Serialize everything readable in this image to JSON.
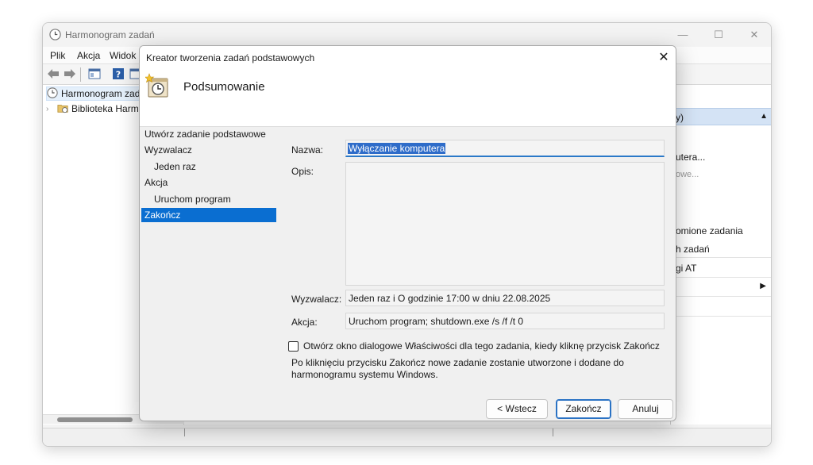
{
  "main_window": {
    "title": "Harmonogram zadań",
    "menu": [
      "Plik",
      "Akcja",
      "Widok"
    ],
    "tree": {
      "root": "Harmonogram zada",
      "library": "Biblioteka Harm"
    },
    "actions_pane": {
      "header": "y)",
      "items": [
        "utera...",
        "owe...",
        "omione zadania",
        "h zadań",
        "gi AT"
      ]
    }
  },
  "dialog": {
    "title": "Kreator tworzenia zadań podstawowych",
    "header_title": "Podsumowanie",
    "steps": [
      {
        "label": "Utwórz zadanie podstawowe"
      },
      {
        "label": "Wyzwalacz"
      },
      {
        "label": "Jeden raz"
      },
      {
        "label": "Akcja"
      },
      {
        "label": "Uruchom program"
      },
      {
        "label": "Zakończ"
      }
    ],
    "name_label": "Nazwa:",
    "name_value": "Wyłączanie komputera",
    "description_label": "Opis:",
    "description_value": "",
    "trigger_label": "Wyzwalacz:",
    "trigger_value": "Jeden raz i O godzinie 17:00 w dniu 22.08.2025",
    "action_label": "Akcja:",
    "action_value": "Uruchom program; shutdown.exe /s /f /t 0",
    "checkbox_label": "Otwórz okno dialogowe Właściwości dla tego zadania, kiedy kliknę przycisk Zakończ",
    "checkbox_checked": false,
    "info_text": "Po kliknięciu przycisku Zakończ nowe zadanie zostanie utworzone i dodane do harmonogramu systemu Windows.",
    "buttons": {
      "back": "< Wstecz",
      "finish": "Zakończ",
      "cancel": "Anuluj"
    }
  }
}
